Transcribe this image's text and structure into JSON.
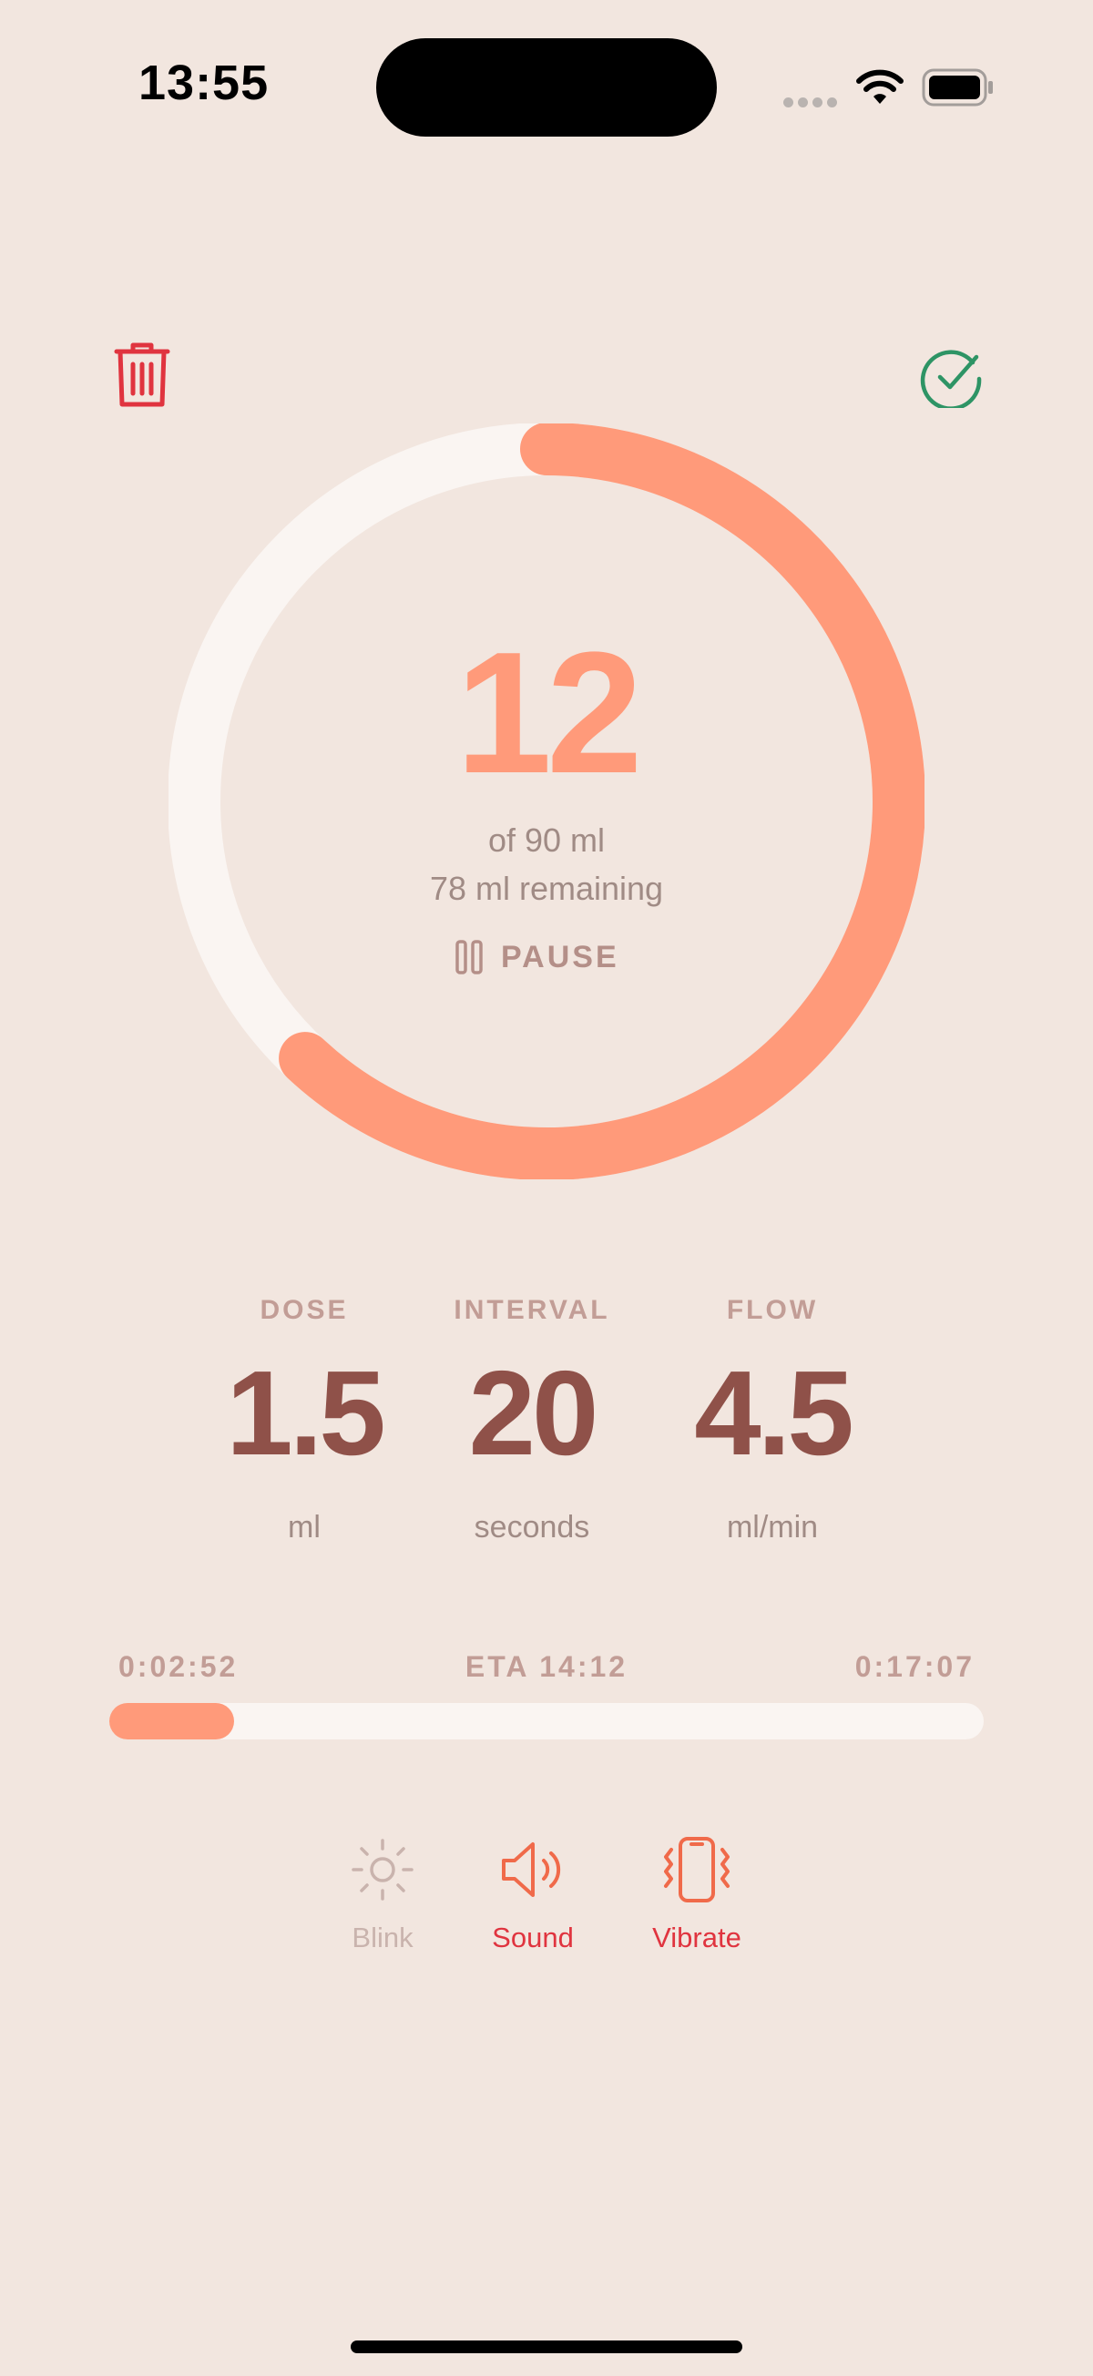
{
  "status_bar": {
    "time": "13:55",
    "wifi_icon": "wifi-icon",
    "battery_icon": "battery-icon"
  },
  "header": {
    "delete_icon": "trash-icon",
    "done_icon": "checkmark-circle-icon"
  },
  "colors": {
    "accent": "#ff9a7a",
    "track": "#faf5f2",
    "danger": "#e0343f",
    "success": "#2e9465",
    "stat_value": "#8f5149",
    "background": "#f2e6df"
  },
  "progress": {
    "current": "12",
    "of_text": "of 90 ml",
    "remaining_text": "78 ml remaining",
    "current_ml": 12,
    "total_ml": 90,
    "ring_fraction_shown": 0.62
  },
  "pause_button": {
    "label": "PAUSE",
    "icon": "pause-icon"
  },
  "stats": [
    {
      "label": "DOSE",
      "value": "1.5",
      "unit": "ml"
    },
    {
      "label": "INTERVAL",
      "value": "20",
      "unit": "seconds"
    },
    {
      "label": "FLOW",
      "value": "4.5",
      "unit": "ml/min"
    }
  ],
  "timeline": {
    "elapsed": "0:02:52",
    "eta": "ETA 14:12",
    "remaining": "0:17:07",
    "progress_fraction": 0.143
  },
  "toggles": [
    {
      "label": "Blink",
      "icon": "sun-icon",
      "enabled": false,
      "color": "#c9b3ad"
    },
    {
      "label": "Sound",
      "icon": "speaker-icon",
      "enabled": true,
      "color": "#e0343f"
    },
    {
      "label": "Vibrate",
      "icon": "phone-vibrate-icon",
      "enabled": true,
      "color": "#e0343f"
    }
  ]
}
